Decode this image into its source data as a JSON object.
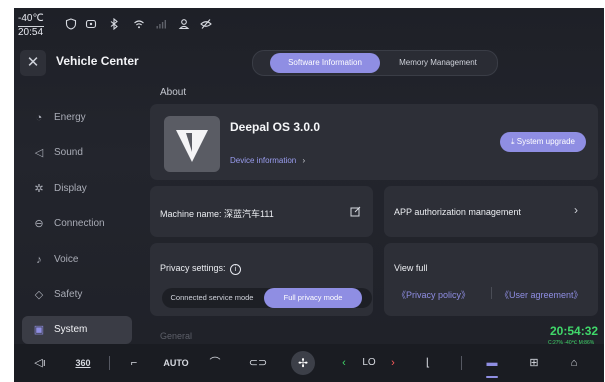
{
  "status_bar": {
    "temperature": "-40℃",
    "time": "20:54",
    "icons": [
      "shield-icon",
      "record-icon",
      "bluetooth-icon",
      "wifi-icon",
      "signal-icon",
      "user-icon",
      "eye-off-icon"
    ]
  },
  "header": {
    "title": "Vehicle Center",
    "tabs": [
      {
        "label": "Software Information",
        "active": true
      },
      {
        "label": "Memory Management",
        "active": false
      }
    ]
  },
  "sidebar": {
    "items": [
      {
        "label": "Energy",
        "icon": "energy-icon",
        "active": false
      },
      {
        "label": "Sound",
        "icon": "speaker-icon",
        "active": false
      },
      {
        "label": "Display",
        "icon": "brightness-icon",
        "active": false
      },
      {
        "label": "Connection",
        "icon": "link-icon",
        "active": false
      },
      {
        "label": "Voice",
        "icon": "mic-icon",
        "active": false
      },
      {
        "label": "Safety",
        "icon": "shield-icon",
        "active": false
      },
      {
        "label": "System",
        "icon": "system-icon",
        "active": true
      }
    ]
  },
  "about": {
    "section_title": "About",
    "os_name": "Deepal OS 3.0.0",
    "device_info": "Device information",
    "upgrade_label": "System upgrade"
  },
  "machine": {
    "label": "Machine name: 深蓝汽车111"
  },
  "app_auth": {
    "label": "APP authorization management"
  },
  "privacy": {
    "label": "Privacy settings:",
    "modes": [
      "Connected service mode",
      "Full privacy mode"
    ],
    "selected": "Full privacy mode"
  },
  "view_full": {
    "label": "View full",
    "links": [
      "《Privacy policy》",
      "《User agreement》"
    ]
  },
  "general_label": "General",
  "clock": {
    "time": "20:54:32",
    "sub": "C:27% -40℃ M:86%"
  },
  "dock": {
    "items": [
      "speaker-icon",
      "360",
      "seat-heat-icon",
      "AUTO",
      "defrost-icon",
      "car-vent-icon",
      "fan-icon",
      "LO",
      "seat-icon",
      "car-icon",
      "apps-icon",
      "home-icon"
    ],
    "temp_setting": "LO",
    "auto_label": "AUTO",
    "view_label": "360"
  },
  "colors": {
    "accent": "#8f8ee3",
    "background": "#1f2128",
    "card": "#2d2f37",
    "clock_green": "#40d86a"
  }
}
